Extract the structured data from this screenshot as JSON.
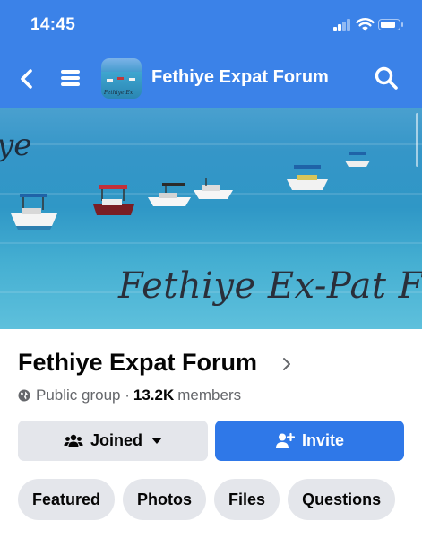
{
  "status_bar": {
    "time": "14:45"
  },
  "header": {
    "title": "Fethiye Expat Forum",
    "thumbnail_caption": "Fethiye Ex"
  },
  "cover": {
    "overlay_top": "ye",
    "overlay_bottom": "Fethiye Ex-Pat Fo"
  },
  "group": {
    "name": "Fethiye Expat Forum",
    "privacy": "Public group ·",
    "member_count": "13.2K",
    "members_label": "members"
  },
  "actions": {
    "joined_label": "Joined",
    "invite_label": "Invite"
  },
  "tabs": [
    {
      "label": "Featured"
    },
    {
      "label": "Photos"
    },
    {
      "label": "Files"
    },
    {
      "label": "Questions"
    }
  ],
  "colors": {
    "brand_blue": "#3b82e8",
    "button_blue": "#2f78e8",
    "chip_gray": "#e4e6eb",
    "secondary_text": "#65676b"
  }
}
